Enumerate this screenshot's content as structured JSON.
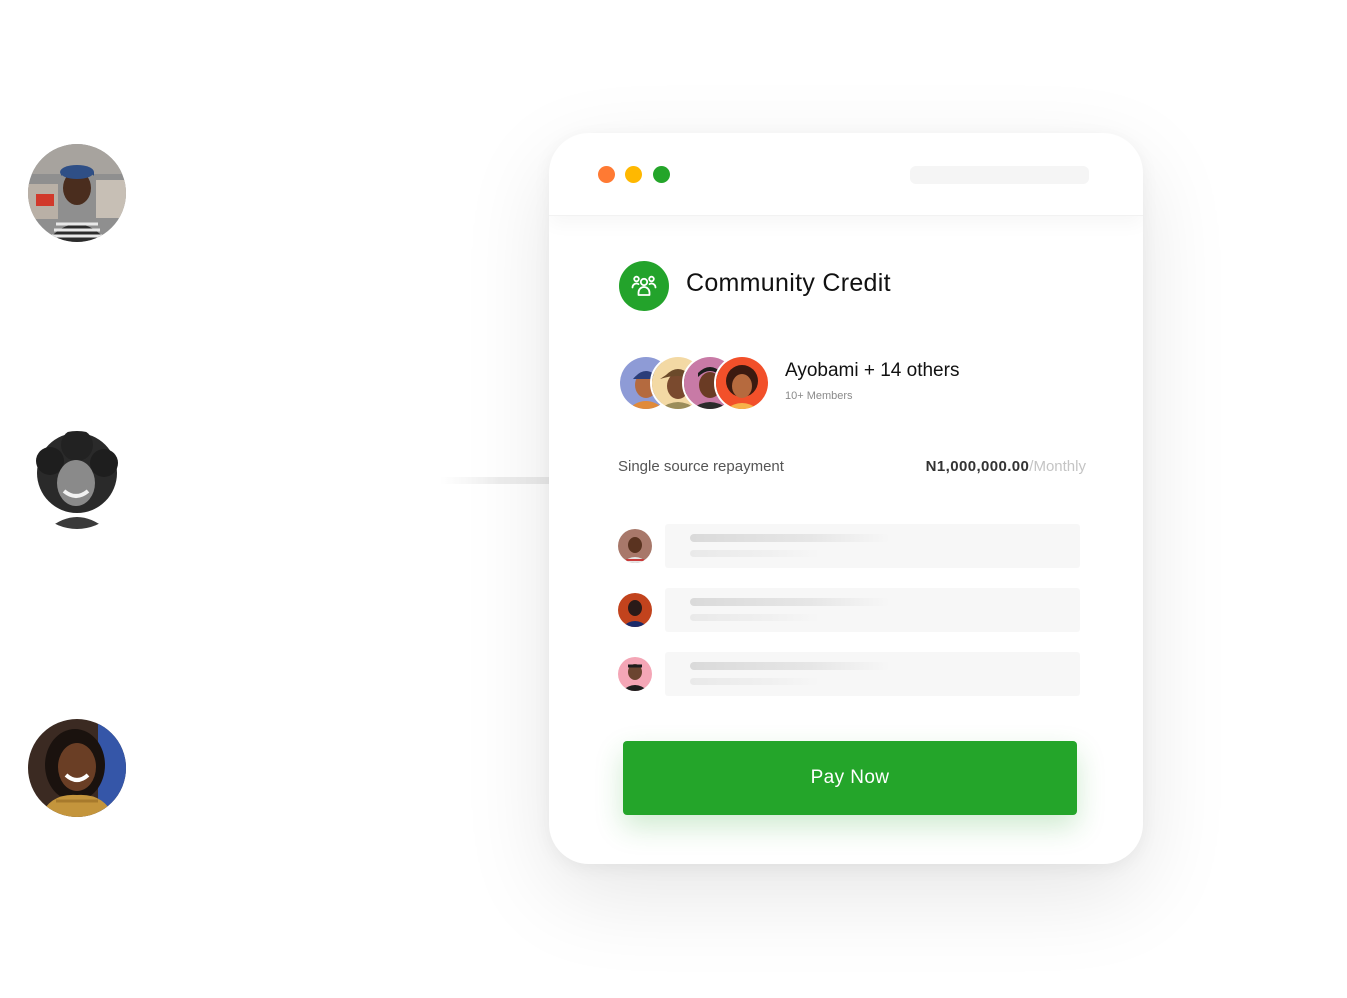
{
  "colors": {
    "brand_green": "#24a52a",
    "dot_red": "#ff7a33",
    "dot_yellow": "#ffb800",
    "dot_green": "#24a52a"
  },
  "window": {
    "controls": [
      "close-dot",
      "minimize-dot",
      "maximize-dot"
    ]
  },
  "header": {
    "icon": "users-group-icon",
    "title": "Community Credit"
  },
  "members": {
    "name": "Ayobami + 14 others",
    "count": "10+ Members"
  },
  "repayment": {
    "label": "Single source repayment",
    "amount": "N1,000,000.00",
    "period": "/Monthly"
  },
  "pay_button": {
    "label": "Pay Now"
  }
}
